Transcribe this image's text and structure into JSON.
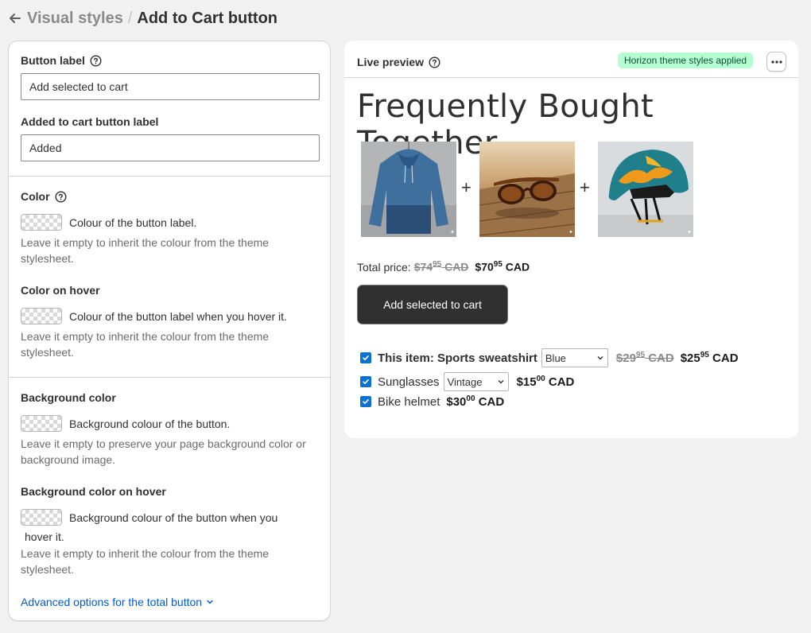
{
  "breadcrumb": {
    "parent": "Visual styles",
    "separator": "/",
    "current": "Add to Cart button"
  },
  "settings": {
    "button_label": {
      "label": "Button label",
      "value": "Add selected to cart"
    },
    "added_label": {
      "label": "Added to cart button label",
      "value": "Added"
    },
    "color": {
      "label": "Color",
      "swatch_text": "Colour of the button label.",
      "help": "Leave it empty to inherit the colour from the theme stylesheet."
    },
    "color_hover": {
      "label": "Color on hover",
      "swatch_text": "Colour of the button label when you hover it.",
      "help": "Leave it empty to inherit the colour from the theme stylesheet."
    },
    "bg_color": {
      "label": "Background color",
      "swatch_text": "Background colour of the button.",
      "help": "Leave it empty to preserve your page background color or background image."
    },
    "bg_color_hover": {
      "label": "Background color on hover",
      "swatch_text_1": "Background colour of the button when you",
      "swatch_text_2": "hover it.",
      "help": "Leave it empty to inherit the colour from the theme stylesheet."
    },
    "advanced_link": "Advanced options for the total button"
  },
  "preview": {
    "title": "Live preview",
    "badge": "Horizon theme styles applied",
    "widget_title": "Frequently Bought Together",
    "plus": "+",
    "total_label": "Total price:",
    "total_old": {
      "main": "$74",
      "cents": "95",
      "currency": "CAD"
    },
    "total_new": {
      "main": "$70",
      "cents": "95",
      "currency": "CAD"
    },
    "cart_button": "Add selected to cart",
    "items": [
      {
        "prefix": "This item:",
        "name": "Sports sweatshirt",
        "variant": "Blue",
        "old": {
          "main": "$29",
          "cents": "95",
          "currency": "CAD"
        },
        "new": {
          "main": "$25",
          "cents": "95",
          "currency": "CAD"
        }
      },
      {
        "name": "Sunglasses",
        "variant": "Vintage",
        "new": {
          "main": "$15",
          "cents": "00",
          "currency": "CAD"
        }
      },
      {
        "name": "Bike helmet",
        "new": {
          "main": "$30",
          "cents": "00",
          "currency": "CAD"
        }
      }
    ]
  },
  "colors": {
    "accent": "#005bd3",
    "badge_bg": "#b4fed2",
    "checkbox": "#0c72d1",
    "button_bg": "#303030"
  }
}
